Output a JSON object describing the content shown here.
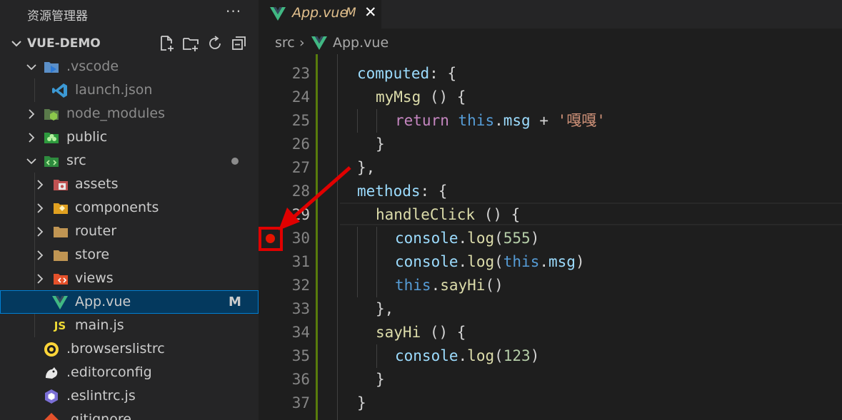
{
  "sidebar": {
    "title": "资源管理器",
    "more": "···",
    "project": "VUE-DEMO",
    "items": [
      {
        "label": ".vscode",
        "icon": "vscode-folder-icon",
        "dim": true
      },
      {
        "label": "launch.json",
        "icon": "vscode-icon",
        "dim": true
      },
      {
        "label": "node_modules",
        "icon": "node-folder-icon",
        "dim": true
      },
      {
        "label": "public",
        "icon": "public-folder-icon",
        "dim": false
      },
      {
        "label": "src",
        "icon": "src-folder-icon",
        "dim": false
      },
      {
        "label": "assets",
        "icon": "assets-folder-icon",
        "dim": false
      },
      {
        "label": "components",
        "icon": "components-folder-icon",
        "dim": false
      },
      {
        "label": "router",
        "icon": "folder-icon",
        "dim": false
      },
      {
        "label": "store",
        "icon": "folder-icon",
        "dim": false
      },
      {
        "label": "views",
        "icon": "views-folder-icon",
        "dim": false
      },
      {
        "label": "App.vue",
        "icon": "vue-icon",
        "dim": false,
        "badge": "M"
      },
      {
        "label": "main.js",
        "icon": "js-icon",
        "dim": false
      },
      {
        "label": ".browserslistrc",
        "icon": "browserslist-icon",
        "dim": false
      },
      {
        "label": ".editorconfig",
        "icon": "editorconfig-icon",
        "dim": false
      },
      {
        "label": ".eslintrc.js",
        "icon": "eslint-icon",
        "dim": false
      },
      {
        "label": ".gitignore",
        "icon": "git-icon",
        "dim": false
      }
    ]
  },
  "tab": {
    "name": "App.vue",
    "modified": "M",
    "close": "✕"
  },
  "breadcrumb": {
    "folder": "src",
    "sep": "›",
    "file": "App.vue"
  },
  "code": {
    "line_numbers": [
      "23",
      "24",
      "25",
      "26",
      "27",
      "28",
      "29",
      "30",
      "31",
      "32",
      "33",
      "34",
      "35",
      "36",
      "37"
    ],
    "active_line": "29",
    "breakpoint_line": "30"
  },
  "colors": {
    "breakpoint": "#e51400",
    "accent": "#007fd4",
    "modified": "#e2c08d"
  }
}
